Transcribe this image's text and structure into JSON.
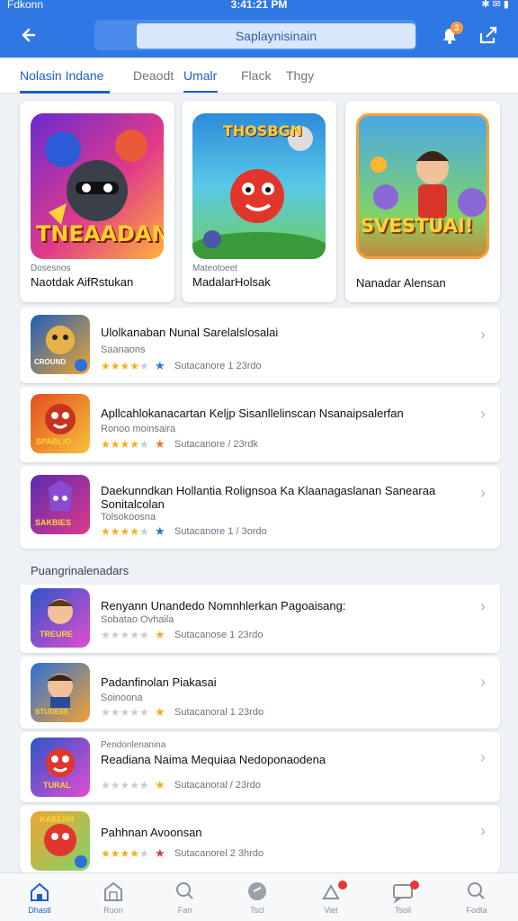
{
  "status": {
    "carrier": "Fdkonn",
    "time": "3:41:21 PM"
  },
  "search": {
    "value": "Saplaynisinain"
  },
  "header": {
    "notification_count": "3"
  },
  "tabs": [
    {
      "label": "Nolasin Indane",
      "active": true
    },
    {
      "label": "Deaodt",
      "active": false
    },
    {
      "label": "Umalr",
      "active": false
    },
    {
      "label": "Flack",
      "active": false
    },
    {
      "label": "Thgy",
      "active": false
    }
  ],
  "featured": [
    {
      "sub": "Dosesnos",
      "title": "Naotdak AifRstukan",
      "art_text": "TNEAADAN"
    },
    {
      "sub": "Mateotoeet",
      "title": "MadalarHolsak",
      "art_text": "THOSBGN"
    },
    {
      "sub": "",
      "title": "Nanadar Alensan",
      "art_text": "SVESTUAI!"
    }
  ],
  "apps": [
    {
      "title": "Ulolkanaban Nunal Sarelalslosalai",
      "sub": "Saanaons",
      "meta": "Sutacanore 1 23rdo",
      "badge_color": "#2f6fd6",
      "art_text": "CROUND"
    },
    {
      "title": "Apllcahlokanacartan Keljp Sisanllelinscan Nsanaipsalerfan",
      "sub": "Ronoo moinsaira",
      "meta": "Sutacanore / 23rdk",
      "badge_color": "#f07a1f",
      "art_text": "SPABLIO"
    },
    {
      "title": "Daekunndkan Hollantia Rolignsoa Ka Klaanagaslanan Sanearaa Sonitalcolan",
      "sub": "Tolsokoosna",
      "meta": "Sutacanore 1 / 3ordo",
      "badge_color": "#2f6fd6",
      "art_text": "SAKBIES"
    }
  ],
  "section": {
    "title": "Puangrinalenadars"
  },
  "apps2": [
    {
      "title": "Renyann Unandedo Nomnhlerkan Pagoaisang:",
      "sub": "Sobatao Ovhaila",
      "meta": "Sutacanose 1 23rdo",
      "badge_color": "#f2b01e",
      "art_text": "TREURE"
    },
    {
      "title": "Padanfinolan Piakasai",
      "sub": "Soinoona",
      "meta": "Sutacanoral 1 23rdo",
      "badge_color": "#f2b01e",
      "art_text": "STUDEIIS"
    },
    {
      "title": "Readiana Naima Mequiaa Nedoponaodena",
      "sub": "Pendonlenanina",
      "meta": "Sutacanoral / 23rdo",
      "badge_color": "#f2b01e",
      "art_text": "TURAL"
    },
    {
      "title": "Pahhnan Avoonsan",
      "sub": "",
      "meta": "Sutacanorel 2 3hrdo",
      "badge_color": "#e53935",
      "art_text": "KABERR"
    }
  ],
  "nav": [
    {
      "label": "Dhastl",
      "icon": "home-icon",
      "active": true
    },
    {
      "label": "Ruon",
      "icon": "store-icon",
      "active": false
    },
    {
      "label": "Farr",
      "icon": "search-icon",
      "active": false
    },
    {
      "label": "Tscl",
      "icon": "game-icon",
      "active": false
    },
    {
      "label": "Viet",
      "icon": "gift-icon",
      "active": false
    },
    {
      "label": "Tsoll",
      "icon": "chat-icon",
      "active": false
    },
    {
      "label": "Fodta",
      "icon": "search-alt-icon",
      "active": false
    }
  ],
  "colors": {
    "primary": "#2f78e4",
    "accent": "#1d5fc9",
    "star": "#f2b01e"
  }
}
